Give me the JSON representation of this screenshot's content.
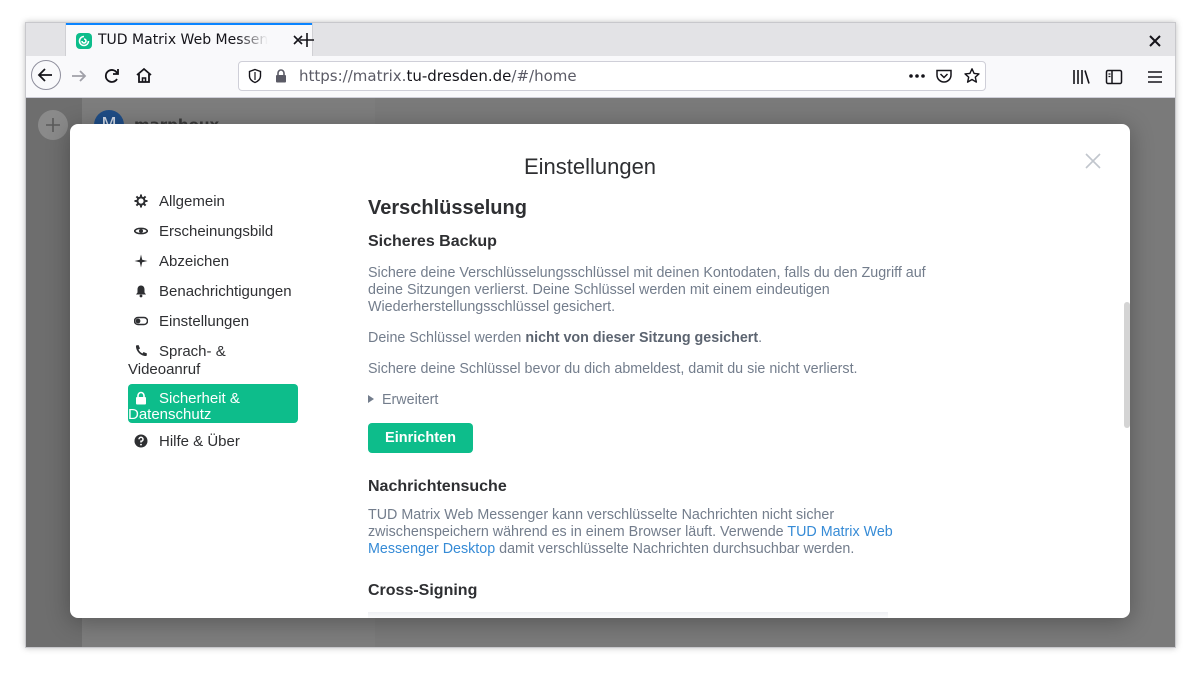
{
  "browser": {
    "tab_title": "TUD Matrix Web Messenger",
    "url_prefix": "https://matrix.",
    "url_domain": "tu-dresden.de",
    "url_suffix": "/#/home"
  },
  "background": {
    "avatar_letter": "M",
    "user_name": "marphoux"
  },
  "dialog": {
    "title": "Einstellungen",
    "nav": [
      {
        "label": "Allgemein",
        "icon": "gear-icon"
      },
      {
        "label": "Erscheinungsbild",
        "icon": "eye-icon"
      },
      {
        "label": "Abzeichen",
        "icon": "sparkle-icon"
      },
      {
        "label": "Benachrichtigungen",
        "icon": "bell-icon"
      },
      {
        "label": "Einstellungen",
        "icon": "toggle-icon"
      },
      {
        "label_line1": "Sprach- &",
        "label_line2": "Videoanruf",
        "icon": "phone-icon"
      },
      {
        "label_line1": "Sicherheit &",
        "label_line2": "Datenschutz",
        "icon": "lock-icon",
        "active": true
      },
      {
        "label": "Hilfe & Über",
        "icon": "help-icon"
      }
    ],
    "section_title": "Verschlüsselung",
    "backup": {
      "heading": "Sicheres Backup",
      "description": "Sichere deine Verschlüsselungsschlüssel mit deinen Kontodaten, falls du den Zugriff auf deine Sitzungen verlierst. Deine Schlüssel werden mit einem eindeutigen Wiederherstellungsschlüssel gesichert.",
      "status_prefix": "Deine Schlüssel werden ",
      "status_bold": "nicht von dieser Sitzung gesichert",
      "status_suffix": ".",
      "advice": "Sichere deine Schlüssel bevor du dich abmeldest, damit du sie nicht verlierst.",
      "advanced_label": "Erweitert",
      "setup_button": "Einrichten"
    },
    "search": {
      "heading": "Nachrichtensuche",
      "text_before": "TUD Matrix Web Messenger kann verschlüsselte Nachrichten nicht sicher zwischenspeichern während es in einem Browser läuft. Verwende ",
      "link": "TUD Matrix Web Messenger Desktop",
      "text_after": " damit verschlüsselte Nachrichten durchsuchbar werden."
    },
    "cross_signing": {
      "heading": "Cross-Signing"
    }
  },
  "colors": {
    "accent": "#0dbd8b",
    "link": "#368bd6",
    "text": "#2e2f32",
    "muted": "#737d8c"
  }
}
